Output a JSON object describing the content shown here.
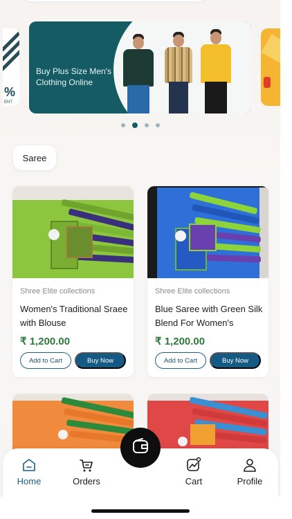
{
  "banner": {
    "main_text": "Buy Plus Size Men's Clothing Online",
    "left_partial_text": "%",
    "left_partial_sub": "ENT",
    "carousel_dot_count": 4,
    "carousel_active_index": 1,
    "colors": {
      "main_bg": "#145b63",
      "right_bg": "#f5b532"
    }
  },
  "category_chip": {
    "label": "Saree"
  },
  "products": [
    {
      "brand": "Shree Elite collections",
      "title": "Women's Traditional Sraee with Blouse",
      "price": "₹ 1,200.00",
      "add_to_cart_label": "Add to Cart",
      "buy_now_label": "Buy Now",
      "image_colors": [
        "#8cc63f",
        "#3a2f7a"
      ]
    },
    {
      "brand": "Shree Elite collections",
      "title": "Blue Saree with Green Silk Blend For Women's",
      "price": "₹ 1,200.00",
      "add_to_cart_label": "Add to Cart",
      "buy_now_label": "Buy Now",
      "image_colors": [
        "#1f6fe0",
        "#8cd43a"
      ]
    }
  ],
  "products_partial": [
    {
      "image_colors": [
        "#f08a3c",
        "#2d8a3a"
      ]
    },
    {
      "image_colors": [
        "#e04848",
        "#3a8fd0"
      ]
    }
  ],
  "bottom_nav": {
    "items": [
      {
        "label": "Home",
        "icon": "home-icon",
        "active": true
      },
      {
        "label": "Orders",
        "icon": "orders-icon",
        "active": false
      },
      {
        "label": "Cart",
        "icon": "cart-chart-icon",
        "active": false
      },
      {
        "label": "Profile",
        "icon": "profile-icon",
        "active": false
      }
    ],
    "center_button_icon": "wallet-icon"
  },
  "colors": {
    "price": "#2d7a3a",
    "accent": "#155a84",
    "active_nav": "#1a5f88"
  }
}
